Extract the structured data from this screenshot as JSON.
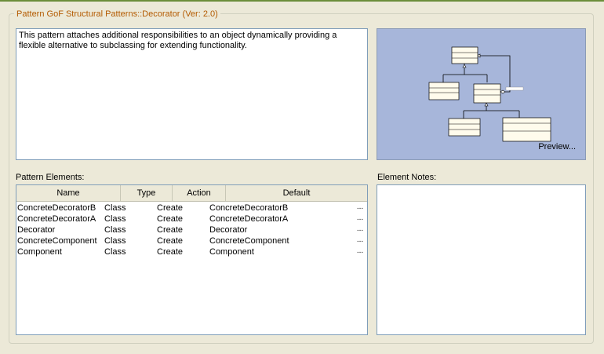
{
  "group_title": "Pattern GoF Structural Patterns::Decorator (Ver: 2.0)",
  "description": "This pattern attaches additional responsibilities to an object dynamically providing a flexible alternative to subclassing for extending functionality.",
  "preview": {
    "label": "Preview..."
  },
  "pattern_elements": {
    "label": "Pattern Elements:",
    "columns": [
      "Name",
      "Type",
      "Action",
      "Default"
    ],
    "rows": [
      {
        "name": "ConcreteDecoratorB",
        "type": "Class",
        "action": "Create",
        "default": "ConcreteDecoratorB",
        "more": "..."
      },
      {
        "name": "ConcreteDecoratorA",
        "type": "Class",
        "action": "Create",
        "default": "ConcreteDecoratorA",
        "more": "..."
      },
      {
        "name": "Decorator",
        "type": "Class",
        "action": "Create",
        "default": "Decorator",
        "more": "..."
      },
      {
        "name": "ConcreteComponent",
        "type": "Class",
        "action": "Create",
        "default": "ConcreteComponent",
        "more": "..."
      },
      {
        "name": "Component",
        "type": "Class",
        "action": "Create",
        "default": "Component",
        "more": "..."
      }
    ]
  },
  "element_notes": {
    "label": "Element Notes:",
    "value": ""
  }
}
